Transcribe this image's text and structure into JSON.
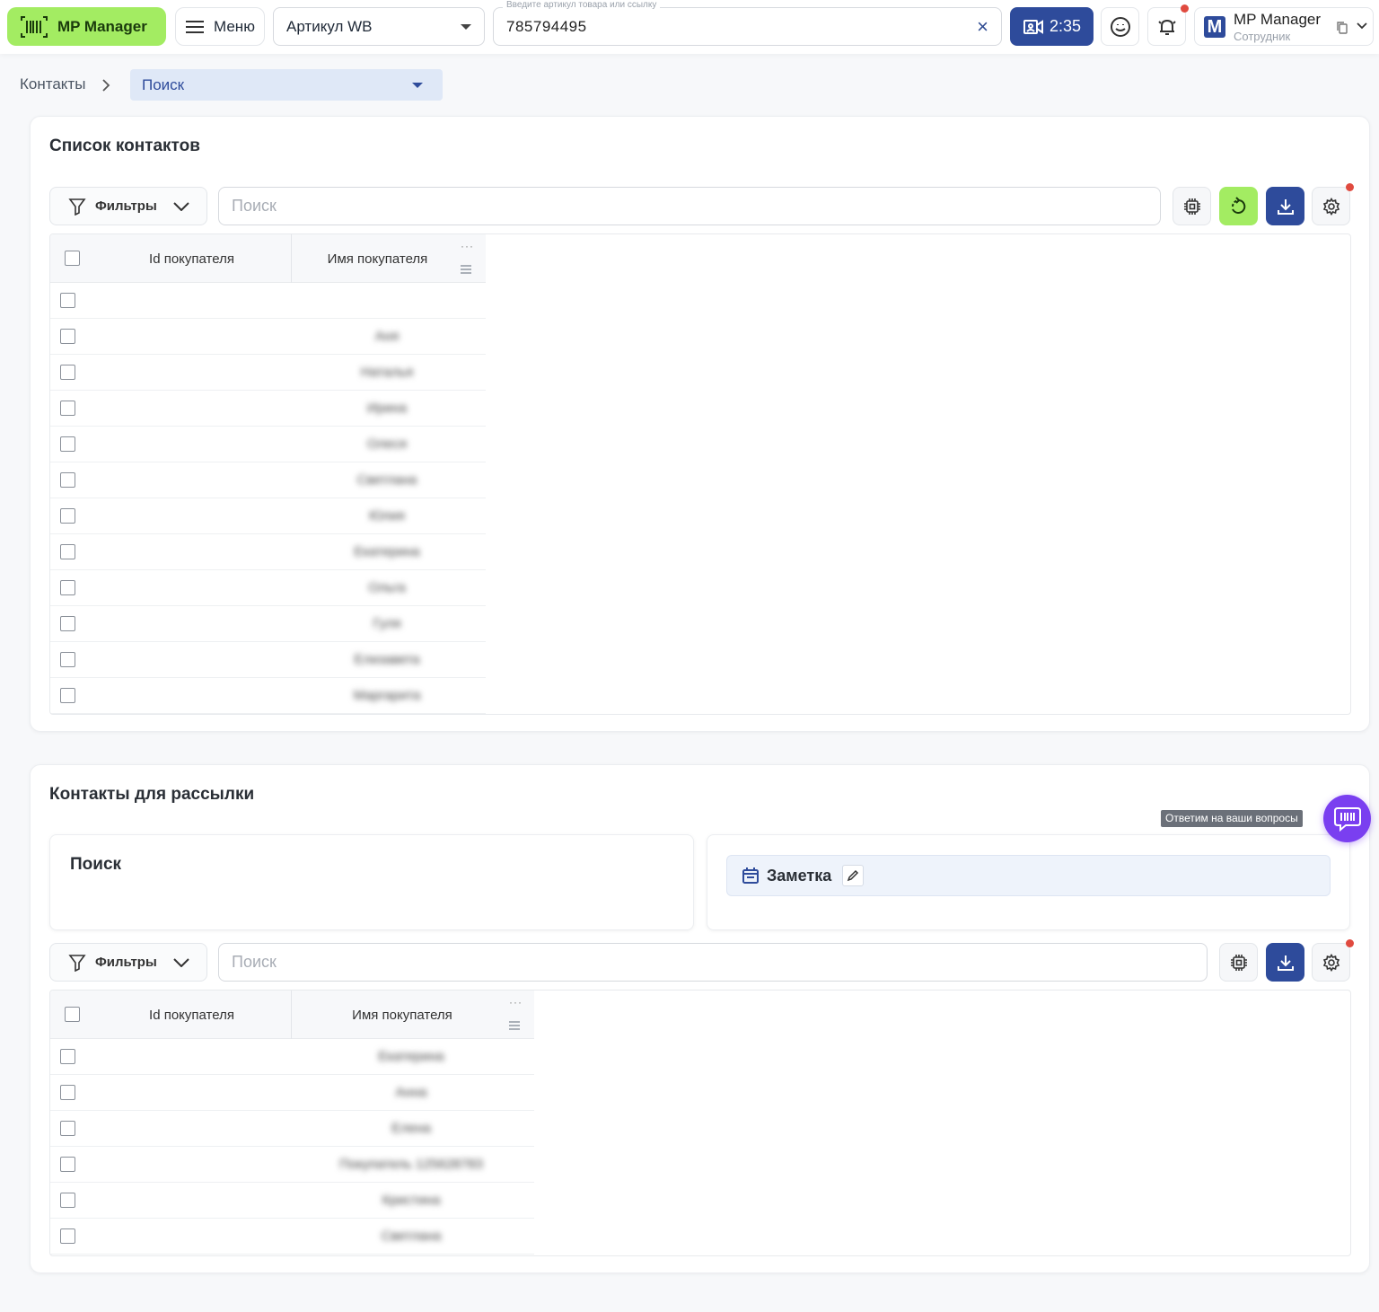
{
  "header": {
    "brand": "MP Manager",
    "menu_label": "Меню",
    "article_type": "Артикул WB",
    "article_input_label": "Введите артикул товара или ссылку",
    "article_value": "785794495",
    "video_timer": "2:35",
    "user_name": "MP Manager",
    "user_role": "Сотрудник",
    "user_initial": "M"
  },
  "breadcrumb": {
    "root": "Контакты",
    "current": "Поиск"
  },
  "contacts_list": {
    "title": "Список контактов",
    "filters_label": "Фильтры",
    "search_placeholder": "Поиск",
    "columns": [
      "Id покупателя",
      "Имя покупателя"
    ],
    "rows": [
      "",
      "Аня",
      "Наталья",
      "Ирина",
      "Олеся",
      "Светлана",
      "Юлия",
      "Екатерина",
      "Ольга",
      "Гуля",
      "Елизавета",
      "Маргарита"
    ]
  },
  "mailing_contacts": {
    "title": "Контакты для рассылки",
    "search_card_title": "Поиск",
    "note_label": "Заметка",
    "filters_label": "Фильтры",
    "search_placeholder": "Поиск",
    "columns": [
      "Id покупателя",
      "Имя покупателя"
    ],
    "rows": [
      "Екатерина",
      "Анна",
      "Елена",
      "Покупатель 125628783",
      "Кристина",
      "Светлана"
    ]
  },
  "support": {
    "tooltip": "Ответим на ваши вопросы"
  },
  "colors": {
    "brand_green": "#a3ec62",
    "primary_blue": "#2e4b9b",
    "support_purple": "#7a3ff0",
    "notification_red": "#e04a3f"
  }
}
